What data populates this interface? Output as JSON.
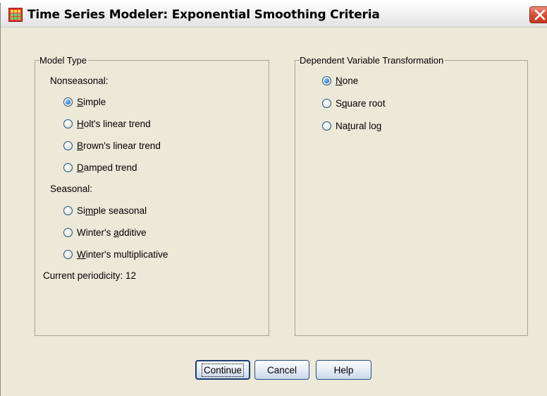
{
  "window": {
    "title": "Time Series Modeler: Exponential Smoothing Criteria"
  },
  "model_type": {
    "legend": "Model Type",
    "nonseasonal_label": "Nonseasonal:",
    "nonseasonal_options": [
      {
        "pre": "",
        "key": "S",
        "post": "imple",
        "checked": true
      },
      {
        "pre": "",
        "key": "H",
        "post": "olt's linear trend",
        "checked": false
      },
      {
        "pre": "",
        "key": "B",
        "post": "rown's linear trend",
        "checked": false
      },
      {
        "pre": "",
        "key": "D",
        "post": "amped trend",
        "checked": false
      }
    ],
    "seasonal_label": "Seasonal:",
    "seasonal_options": [
      {
        "pre": "Si",
        "key": "m",
        "post": "ple seasonal",
        "checked": false
      },
      {
        "pre": "Winter's ",
        "key": "a",
        "post": "dditive",
        "checked": false
      },
      {
        "pre": "",
        "key": "W",
        "post": "inter's multiplicative",
        "checked": false
      }
    ],
    "periodicity": "Current periodicity: 12"
  },
  "transformation": {
    "legend": "Dependent Variable Transformation",
    "options": [
      {
        "pre": "",
        "key": "N",
        "post": "one",
        "checked": true
      },
      {
        "pre": "S",
        "key": "q",
        "post": "uare root",
        "checked": false
      },
      {
        "pre": "Na",
        "key": "t",
        "post": "ural log",
        "checked": false
      }
    ]
  },
  "buttons": {
    "continue": "Continue",
    "cancel": "Cancel",
    "help": "Help"
  },
  "colors": {
    "accent": "#1b5fa8",
    "close": "#c43a22",
    "face": "#ece9d8"
  },
  "icons": {
    "app": "grid-table-icon",
    "close": "close-icon"
  }
}
